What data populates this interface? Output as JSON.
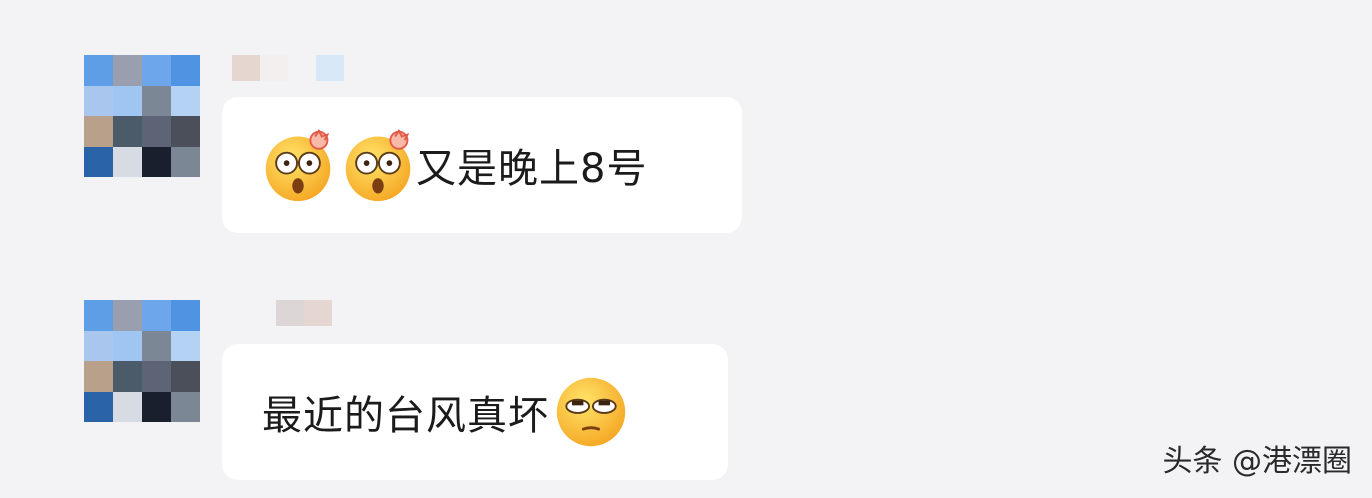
{
  "messages": [
    {
      "avatar_pixels": [
        "#5e9ee6",
        "#9a9fb0",
        "#6da6ea",
        "#4f94e3",
        "#a8c6ee",
        "#9fc6f2",
        "#7b8794",
        "#b4d2f4",
        "#b8a08a",
        "#4b5b6a",
        "#5d6475",
        "#4a4f5a",
        "#2a63a8",
        "#d6dbe4",
        "#1a1f2e",
        "#7c8796"
      ],
      "name_pixels": [
        "#e6d6d0",
        "#f3efef",
        "#f3f3f5",
        "#d8e8f6"
      ],
      "emojis": [
        "astonished-face-icon",
        "astonished-face-icon"
      ],
      "text": "又是晚上8号"
    },
    {
      "avatar_pixels": [
        "#5e9ee6",
        "#9a9fb0",
        "#6da6ea",
        "#4f94e3",
        "#a8c6ee",
        "#9fc6f2",
        "#7b8794",
        "#b4d2f4",
        "#b8a08a",
        "#4b5b6a",
        "#5d6475",
        "#4a4f5a",
        "#2a63a8",
        "#d6dbe4",
        "#1a1f2e",
        "#7c8796"
      ],
      "name_pixels": [
        "#dcd6d6",
        "#e6d6d2"
      ],
      "text": "最近的台风真坏",
      "emojis": [
        "eye-roll-face-icon"
      ]
    }
  ],
  "watermark": "头条 @港漂圈",
  "colors": {
    "background": "#f3f3f5",
    "bubble": "#ffffff",
    "text": "#1b1b1b"
  }
}
